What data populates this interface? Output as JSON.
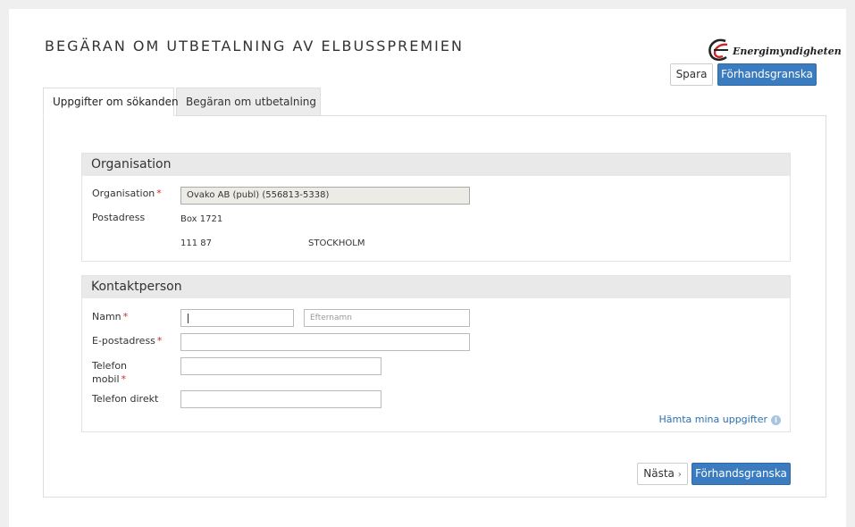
{
  "header": {
    "title": "BEGÄRAN OM UTBETALNING AV ELBUSSPREMIEN",
    "logo_text": "Energimyndigheten",
    "save_label": "Spara",
    "preview_label": "Förhandsgranska"
  },
  "tabs": [
    {
      "label": "Uppgifter om sökanden",
      "active": true
    },
    {
      "label": "Begäran om utbetalning",
      "active": false
    }
  ],
  "organisation": {
    "heading": "Organisation",
    "org_label": "Organisation",
    "org_value": "Ovako AB (publ) (556813-5338)",
    "address_label": "Postadress",
    "address_line1": "Box 1721",
    "postal_code": "111 87",
    "city": "STOCKHOLM"
  },
  "contact": {
    "heading": "Kontaktperson",
    "name_label": "Namn",
    "firstname_value": "",
    "lastname_placeholder": "Efternamn",
    "email_label": "E-postadress",
    "email_value": "",
    "mobile_label_line1": "Telefon",
    "mobile_label_line2": "mobil",
    "mobile_value": "",
    "direct_label": "Telefon direkt",
    "direct_value": "",
    "fetch_link": "Hämta mina uppgifter"
  },
  "footer": {
    "next_label": "Nästa",
    "next_icon": "chevron-right-icon",
    "preview_label": "Förhandsgranska"
  },
  "colors": {
    "primary": "#3a7cbf",
    "required": "#c9302c",
    "link": "#2a6fb0",
    "logo_red": "#d2232a"
  },
  "required_marker": "*"
}
